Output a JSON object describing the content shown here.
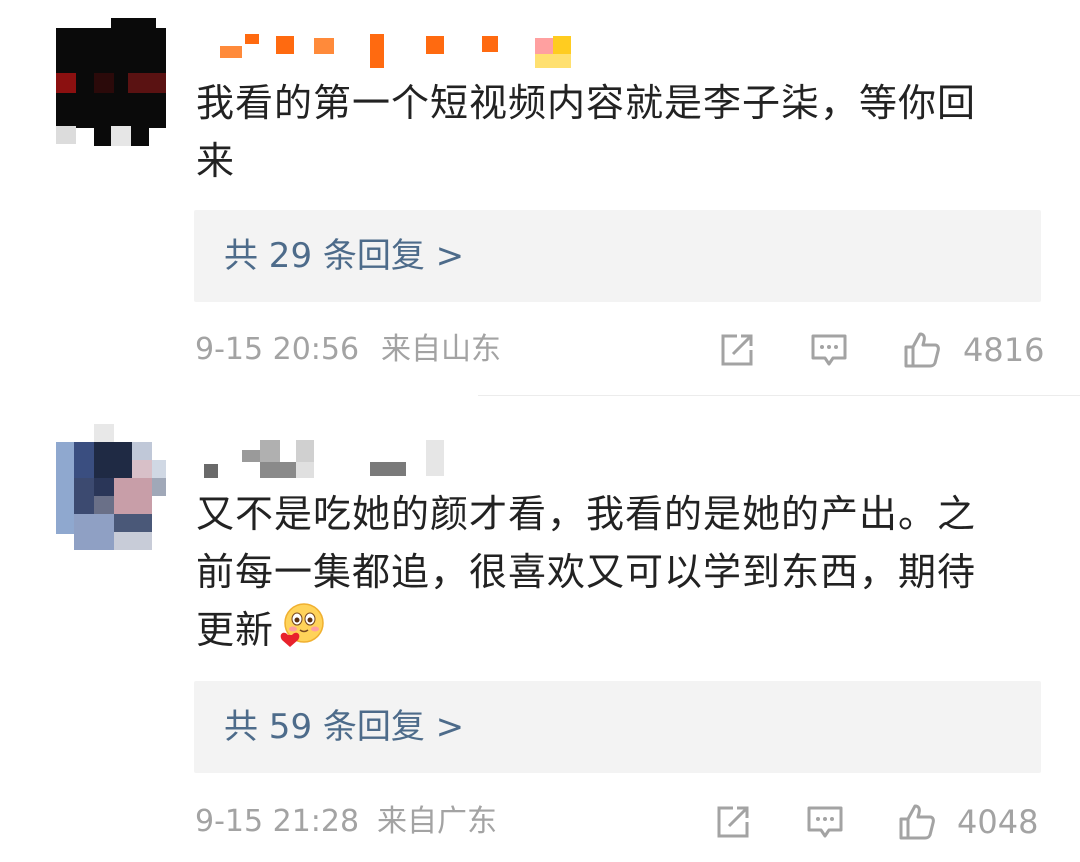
{
  "comments": [
    {
      "text_line1": "我看的第一个短视频内容就是李子柒，等你回",
      "text_line2": "来",
      "replies_label": "共 29 条回复 >",
      "timestamp": "9-15 20:56",
      "location": "来自山东",
      "likes": "4816"
    },
    {
      "text_line1": "又不是吃她的颜才看，我看的是她的产出。之",
      "text_line2": "前每一集都追，很喜欢又可以学到东西，期待",
      "text_line3": "更新",
      "emoji": "heart-eyes-emoji",
      "replies_label": "共 59 条回复 >",
      "timestamp": "9-15 21:28",
      "location": "来自广东",
      "likes": "4048"
    }
  ],
  "icons": {
    "share": "share-icon",
    "comment": "comment-icon",
    "like": "thumbs-up-icon"
  },
  "colors": {
    "text": "#222222",
    "link": "#4d6b8a",
    "meta": "#a3a3a3",
    "reply_bg": "#f3f3f3"
  }
}
